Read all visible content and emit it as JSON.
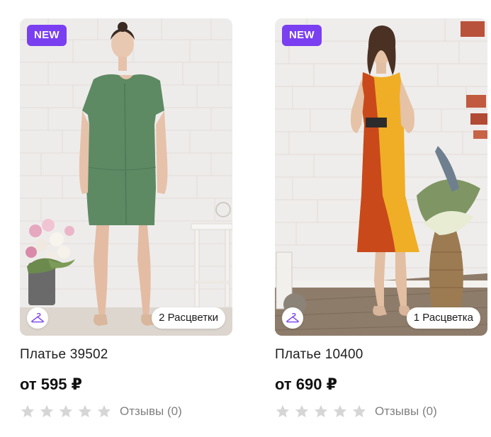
{
  "colors": {
    "accent": "#7a3ff0",
    "star_empty": "#d6d6d6",
    "review_text": "#808080"
  },
  "products": [
    {
      "badge": "NEW",
      "image_alt": "Model in green short-sleeve dress",
      "colors_count_label": "2 Расцветки",
      "hanger_icon": "hanger-icon",
      "title": "Платье 39502",
      "price": "от 595 ₽",
      "rating": 0,
      "max_rating": 5,
      "reviews_label": "Отзывы (0)"
    },
    {
      "badge": "NEW",
      "image_alt": "Model in orange and yellow sleeveless dress",
      "colors_count_label": "1 Расцветка",
      "hanger_icon": "hanger-icon",
      "title": "Платье 10400",
      "price": "от 690 ₽",
      "rating": 0,
      "max_rating": 5,
      "reviews_label": "Отзывы (0)"
    }
  ]
}
